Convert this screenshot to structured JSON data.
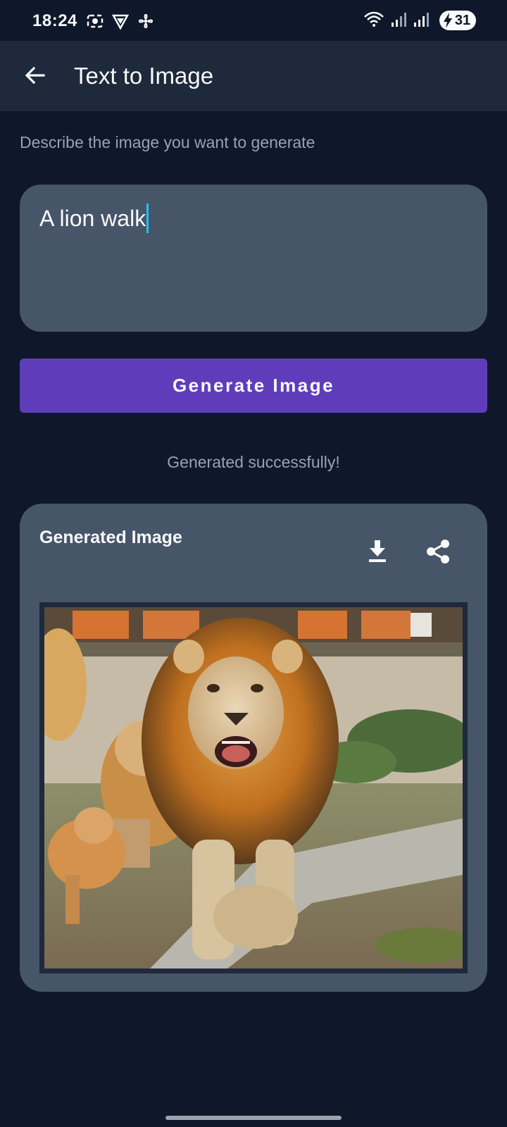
{
  "status_bar": {
    "time": "18:24",
    "battery_level": "31",
    "icons_left": [
      "screen-record-icon",
      "vpn-shield-icon",
      "fan-icon"
    ],
    "icons_right": [
      "wifi-icon",
      "signal-1-icon",
      "signal-2-icon",
      "battery-charging-icon"
    ]
  },
  "app_bar": {
    "title": "Text to Image",
    "back_icon": "arrow-left-icon"
  },
  "prompt": {
    "label": "Describe the image you want to generate",
    "value": "A lion walk"
  },
  "generate_button": {
    "label": "Generate Image",
    "color": "#5f3dba"
  },
  "status_message": "Generated successfully!",
  "result_card": {
    "title": "Generated Image",
    "download_icon": "download-icon",
    "share_icon": "share-icon"
  },
  "colors": {
    "background": "#0f172a",
    "app_bar": "#1e293b",
    "surface": "#475569",
    "accent": "#5f3dba",
    "caret": "#22c1ee"
  }
}
